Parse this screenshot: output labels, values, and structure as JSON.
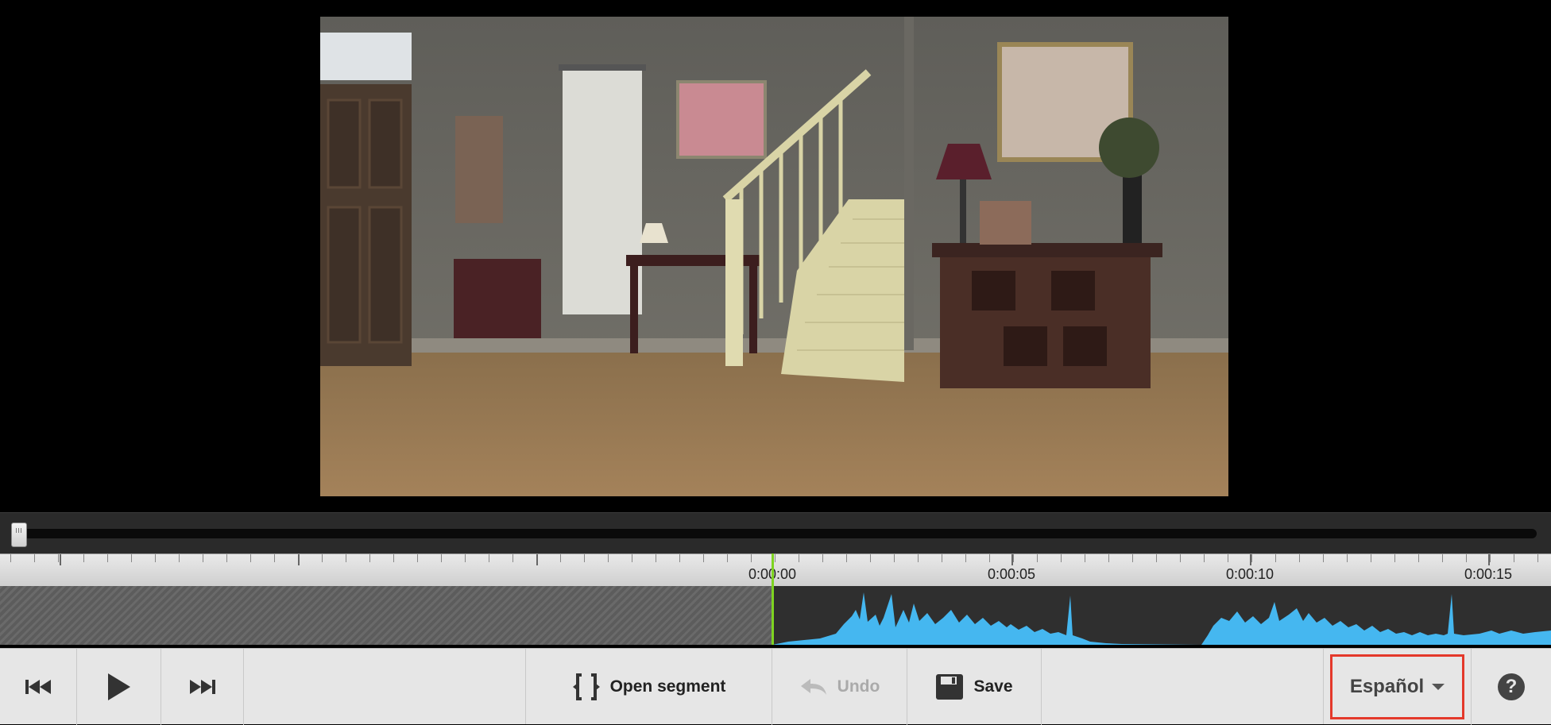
{
  "timeline": {
    "labels": [
      "0:00:00",
      "0:00:05",
      "0:00:10",
      "0:00:15"
    ]
  },
  "toolbar": {
    "prev_icon": "skip-back-icon",
    "play_icon": "play-icon",
    "next_icon": "skip-forward-icon",
    "open_segment_label": "Open segment",
    "undo_label": "Undo",
    "save_label": "Save",
    "language_label": "Español",
    "help_label": "?"
  },
  "colors": {
    "playhead": "#7ed321",
    "waveform": "#45b7f0",
    "highlight": "#e4392b"
  }
}
